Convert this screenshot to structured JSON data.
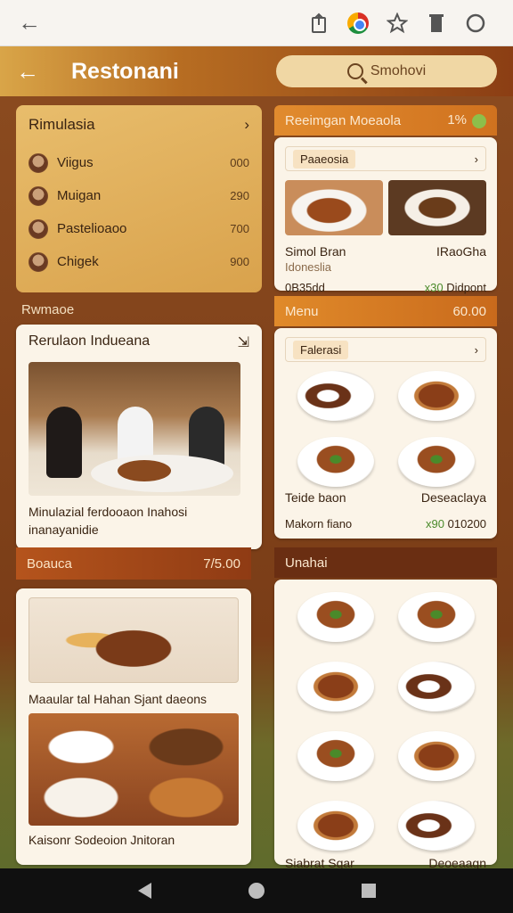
{
  "browser": {
    "back_icon": "←",
    "icons": [
      "share-icon",
      "chrome-icon",
      "star-icon",
      "trash-icon",
      "circle-icon"
    ]
  },
  "header": {
    "title": "Restonani",
    "search_placeholder": "Smohovi"
  },
  "rankings": {
    "title": "Rimulasia",
    "chevron": "›",
    "items": [
      {
        "name": "Viigus",
        "value": "000"
      },
      {
        "name": "Muigan",
        "value": "290"
      },
      {
        "name": "Pastelioaoo",
        "value": "700"
      },
      {
        "name": "Chigek",
        "value": "900"
      }
    ]
  },
  "left_label": "Rwmaoe",
  "feature": {
    "title": "Rerulaon Indueana",
    "caption": "Minulazial ferdooaon Inahosi inanayanidie"
  },
  "orange_bar": {
    "label": "Boauca",
    "value": "7/5.00"
  },
  "feast": {
    "caption": "Maaular tal Hahan Sjant daeons",
    "caption2": "Kaisonr Sodeoion Jnitoran"
  },
  "rbar1": {
    "label": "Reeimgan Moeaola",
    "value": "1%"
  },
  "rcard1": {
    "tag": "Paaeosia",
    "name_left": "Simol Bran",
    "name_right": "IRaoGha",
    "sub": "Idoneslia",
    "foot_left": "0B35dd",
    "foot_mid": "x30",
    "foot_right": "Didpont"
  },
  "rbar2": {
    "label": "Menu",
    "value": "60.00"
  },
  "rcard2": {
    "tag": "Falerasi",
    "name_left": "Teide baon",
    "name_right": "Deseaclaya",
    "foot_left": "Makorn fiano",
    "foot_mid": "x90",
    "foot_right": "010200"
  },
  "rbar3": {
    "label": "Unahai"
  },
  "rcard3": {
    "name_left": "Siabrat Sqar",
    "name_right": "Deoeaagn"
  },
  "colors": {
    "accent": "#d0721f",
    "brand_dark": "#8a4a1f",
    "gold": "#e8bd6c"
  }
}
